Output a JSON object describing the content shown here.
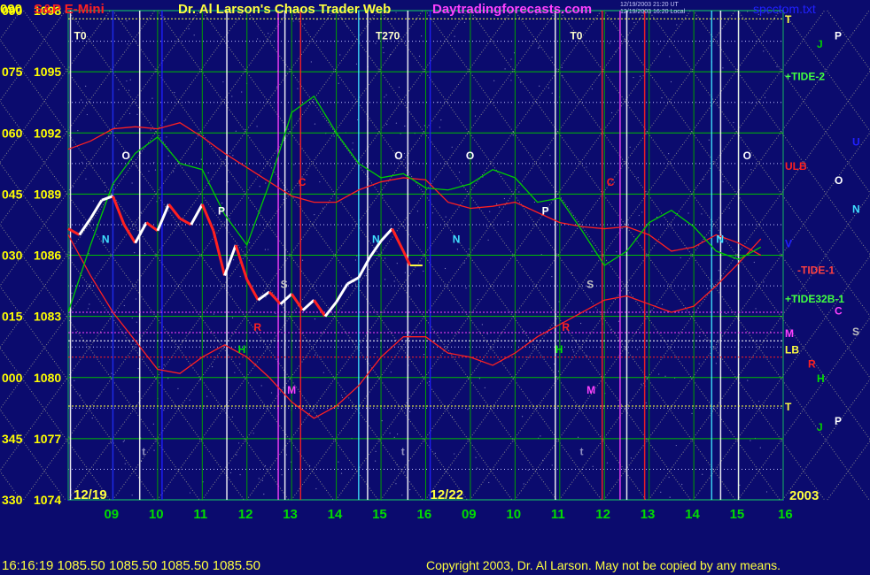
{
  "header": {
    "symbol": "S&P E-Mini",
    "title": "Dr. Al Larson's Chaos Trader Web",
    "site": "Daytradingforecasts.com",
    "timestamp_ut": "12/19/2003 21:20 UT",
    "timestamp_local": "12/19/2003 16:20 Local",
    "file": "spcctom.txt"
  },
  "footer": {
    "quote": "16:16:19  1085.50 1085.50 1085.50 1085.50",
    "copyright": "Copyright 2003, Dr. Al Larson. May not be copied by any means."
  },
  "colors": {
    "background": "#0b0b6e",
    "price_up": "#ffffff",
    "price_down": "#ff2020",
    "grid_green": "#00c000",
    "dotted_yellow": "#e8e8a0",
    "tide_green": "#00cc00",
    "ulb_red": "#ff2020"
  },
  "chart_data": {
    "type": "line",
    "ylim": [
      1074,
      1098
    ],
    "y_ticks": [
      {
        "price": "1098",
        "angle": "090"
      },
      {
        "price": "1095",
        "angle": "075"
      },
      {
        "price": "1092",
        "angle": "060"
      },
      {
        "price": "1089",
        "angle": "045"
      },
      {
        "price": "1086",
        "angle": "030"
      },
      {
        "price": "1083",
        "angle": "015"
      },
      {
        "price": "1080",
        "angle": "000"
      },
      {
        "price": "1077",
        "angle": "345"
      },
      {
        "price": "1074",
        "angle": "330"
      }
    ],
    "x_ticks": [
      "09",
      "10",
      "11",
      "12",
      "13",
      "14",
      "15",
      "16",
      "09",
      "10",
      "11",
      "12",
      "13",
      "14",
      "15",
      "16"
    ],
    "date_labels": [
      "12/19",
      "12/22"
    ],
    "year_label": "2003",
    "price_last": 1085.5,
    "price_series": [
      {
        "t": 0.0,
        "v": 1087.3
      },
      {
        "t": 0.25,
        "v": 1087.0
      },
      {
        "t": 0.5,
        "v": 1087.8
      },
      {
        "t": 0.75,
        "v": 1088.7
      },
      {
        "t": 1.0,
        "v": 1088.9
      },
      {
        "t": 1.25,
        "v": 1087.5
      },
      {
        "t": 1.5,
        "v": 1086.6
      },
      {
        "t": 1.75,
        "v": 1087.6
      },
      {
        "t": 2.0,
        "v": 1087.2
      },
      {
        "t": 2.25,
        "v": 1088.5
      },
      {
        "t": 2.5,
        "v": 1087.8
      },
      {
        "t": 2.75,
        "v": 1087.5
      },
      {
        "t": 3.0,
        "v": 1088.5
      },
      {
        "t": 3.25,
        "v": 1087.2
      },
      {
        "t": 3.5,
        "v": 1085.0
      },
      {
        "t": 3.75,
        "v": 1086.5
      },
      {
        "t": 4.0,
        "v": 1084.8
      },
      {
        "t": 4.25,
        "v": 1083.8
      },
      {
        "t": 4.5,
        "v": 1084.2
      },
      {
        "t": 4.75,
        "v": 1083.6
      },
      {
        "t": 5.0,
        "v": 1084.1
      },
      {
        "t": 5.25,
        "v": 1083.3
      },
      {
        "t": 5.5,
        "v": 1083.8
      },
      {
        "t": 5.75,
        "v": 1083.0
      },
      {
        "t": 6.0,
        "v": 1083.7
      },
      {
        "t": 6.25,
        "v": 1084.6
      },
      {
        "t": 6.5,
        "v": 1084.9
      },
      {
        "t": 6.75,
        "v": 1085.9
      },
      {
        "t": 7.0,
        "v": 1086.7
      },
      {
        "t": 7.25,
        "v": 1087.3
      },
      {
        "t": 7.5,
        "v": 1086.2
      },
      {
        "t": 7.65,
        "v": 1085.5
      }
    ],
    "tide_series": [
      {
        "t": 0.0,
        "v": 1083.2
      },
      {
        "t": 0.5,
        "v": 1086.5
      },
      {
        "t": 1.0,
        "v": 1089.5
      },
      {
        "t": 1.5,
        "v": 1091.0
      },
      {
        "t": 2.0,
        "v": 1091.8
      },
      {
        "t": 2.5,
        "v": 1090.5
      },
      {
        "t": 3.0,
        "v": 1090.2
      },
      {
        "t": 3.5,
        "v": 1088.0
      },
      {
        "t": 4.0,
        "v": 1086.5
      },
      {
        "t": 4.5,
        "v": 1089.5
      },
      {
        "t": 5.0,
        "v": 1093.0
      },
      {
        "t": 5.5,
        "v": 1093.8
      },
      {
        "t": 6.0,
        "v": 1092.0
      },
      {
        "t": 6.5,
        "v": 1090.5
      },
      {
        "t": 7.0,
        "v": 1089.8
      },
      {
        "t": 7.5,
        "v": 1090.0
      },
      {
        "t": 8.0,
        "v": 1089.3
      },
      {
        "t": 8.5,
        "v": 1089.2
      },
      {
        "t": 9.0,
        "v": 1089.5
      },
      {
        "t": 9.5,
        "v": 1090.2
      },
      {
        "t": 10.0,
        "v": 1089.8
      },
      {
        "t": 10.5,
        "v": 1088.6
      },
      {
        "t": 11.0,
        "v": 1088.8
      },
      {
        "t": 11.5,
        "v": 1087.2
      },
      {
        "t": 12.0,
        "v": 1085.5
      },
      {
        "t": 12.5,
        "v": 1086.2
      },
      {
        "t": 13.0,
        "v": 1087.6
      },
      {
        "t": 13.5,
        "v": 1088.2
      },
      {
        "t": 14.0,
        "v": 1087.4
      },
      {
        "t": 14.5,
        "v": 1086.2
      },
      {
        "t": 15.0,
        "v": 1085.8
      },
      {
        "t": 15.5,
        "v": 1086.4
      }
    ],
    "ulb_series": [
      {
        "t": 0.0,
        "v": 1091.2
      },
      {
        "t": 0.5,
        "v": 1091.6
      },
      {
        "t": 1.0,
        "v": 1092.2
      },
      {
        "t": 1.5,
        "v": 1092.3
      },
      {
        "t": 2.0,
        "v": 1092.2
      },
      {
        "t": 2.5,
        "v": 1092.5
      },
      {
        "t": 3.0,
        "v": 1091.8
      },
      {
        "t": 3.5,
        "v": 1091.0
      },
      {
        "t": 4.0,
        "v": 1090.3
      },
      {
        "t": 4.5,
        "v": 1089.6
      },
      {
        "t": 5.0,
        "v": 1088.9
      },
      {
        "t": 5.5,
        "v": 1088.6
      },
      {
        "t": 6.0,
        "v": 1088.6
      },
      {
        "t": 6.5,
        "v": 1089.2
      },
      {
        "t": 7.0,
        "v": 1089.6
      },
      {
        "t": 7.5,
        "v": 1089.8
      },
      {
        "t": 8.0,
        "v": 1089.7
      },
      {
        "t": 8.5,
        "v": 1088.6
      },
      {
        "t": 9.0,
        "v": 1088.3
      },
      {
        "t": 9.5,
        "v": 1088.4
      },
      {
        "t": 10.0,
        "v": 1088.6
      },
      {
        "t": 10.5,
        "v": 1088.1
      },
      {
        "t": 11.0,
        "v": 1087.6
      },
      {
        "t": 11.5,
        "v": 1087.4
      },
      {
        "t": 12.0,
        "v": 1087.3
      },
      {
        "t": 12.5,
        "v": 1087.4
      },
      {
        "t": 13.0,
        "v": 1087.0
      },
      {
        "t": 13.5,
        "v": 1086.2
      },
      {
        "t": 14.0,
        "v": 1086.4
      },
      {
        "t": 14.5,
        "v": 1087.0
      },
      {
        "t": 15.0,
        "v": 1086.6
      },
      {
        "t": 15.5,
        "v": 1086.0
      }
    ],
    "lower_red_series": [
      {
        "t": 0.0,
        "v": 1087.0
      },
      {
        "t": 0.5,
        "v": 1085.0
      },
      {
        "t": 1.0,
        "v": 1083.2
      },
      {
        "t": 1.5,
        "v": 1081.8
      },
      {
        "t": 2.0,
        "v": 1080.4
      },
      {
        "t": 2.5,
        "v": 1080.2
      },
      {
        "t": 3.0,
        "v": 1081.0
      },
      {
        "t": 3.5,
        "v": 1081.6
      },
      {
        "t": 4.0,
        "v": 1081.0
      },
      {
        "t": 4.5,
        "v": 1080.0
      },
      {
        "t": 5.0,
        "v": 1078.8
      },
      {
        "t": 5.5,
        "v": 1078.0
      },
      {
        "t": 6.0,
        "v": 1078.6
      },
      {
        "t": 6.5,
        "v": 1079.6
      },
      {
        "t": 7.0,
        "v": 1081.0
      },
      {
        "t": 7.5,
        "v": 1082.0
      },
      {
        "t": 8.0,
        "v": 1082.0
      },
      {
        "t": 8.5,
        "v": 1081.2
      },
      {
        "t": 9.0,
        "v": 1081.0
      },
      {
        "t": 9.5,
        "v": 1080.6
      },
      {
        "t": 10.0,
        "v": 1081.2
      },
      {
        "t": 10.5,
        "v": 1082.0
      },
      {
        "t": 11.0,
        "v": 1082.6
      },
      {
        "t": 11.5,
        "v": 1083.2
      },
      {
        "t": 12.0,
        "v": 1083.8
      },
      {
        "t": 12.5,
        "v": 1084.0
      },
      {
        "t": 13.0,
        "v": 1083.6
      },
      {
        "t": 13.5,
        "v": 1083.2
      },
      {
        "t": 14.0,
        "v": 1083.5
      },
      {
        "t": 14.5,
        "v": 1084.5
      },
      {
        "t": 15.0,
        "v": 1085.6
      },
      {
        "t": 15.5,
        "v": 1086.8
      }
    ],
    "vertical_markers": [
      "T0",
      "T270",
      "T0"
    ],
    "in_chart_labels": [
      {
        "text": "O",
        "t": 1.2,
        "v": 1090.7,
        "color": "#ffffff"
      },
      {
        "text": "O",
        "t": 7.3,
        "v": 1090.7,
        "color": "#ffffff"
      },
      {
        "text": "O",
        "t": 8.9,
        "v": 1090.7,
        "color": "#ffffff"
      },
      {
        "text": "O",
        "t": 15.1,
        "v": 1090.7,
        "color": "#ffffff"
      },
      {
        "text": "N",
        "t": 0.75,
        "v": 1086.6,
        "color": "#40e0ff"
      },
      {
        "text": "N",
        "t": 6.8,
        "v": 1086.6,
        "color": "#40e0ff"
      },
      {
        "text": "N",
        "t": 8.6,
        "v": 1086.6,
        "color": "#40e0ff"
      },
      {
        "text": "N",
        "t": 14.5,
        "v": 1086.6,
        "color": "#40e0ff"
      },
      {
        "text": "P",
        "t": 3.35,
        "v": 1088.0,
        "color": "#ffffff"
      },
      {
        "text": "P",
        "t": 10.6,
        "v": 1088.0,
        "color": "#ffffff"
      },
      {
        "text": "C",
        "t": 5.15,
        "v": 1089.4,
        "color": "#ff2020"
      },
      {
        "text": "C",
        "t": 12.05,
        "v": 1089.4,
        "color": "#ff2020"
      },
      {
        "text": "S",
        "t": 4.75,
        "v": 1084.4,
        "color": "#c0c0c0"
      },
      {
        "text": "S",
        "t": 11.6,
        "v": 1084.4,
        "color": "#c0c0c0"
      },
      {
        "text": "R",
        "t": 4.15,
        "v": 1082.3,
        "color": "#ff2020"
      },
      {
        "text": "R",
        "t": 11.05,
        "v": 1082.3,
        "color": "#ff2020"
      },
      {
        "text": "H",
        "t": 3.8,
        "v": 1081.2,
        "color": "#00e000"
      },
      {
        "text": "H",
        "t": 10.9,
        "v": 1081.2,
        "color": "#00e000"
      },
      {
        "text": "M",
        "t": 4.9,
        "v": 1079.2,
        "color": "#ff40ff"
      },
      {
        "text": "M",
        "t": 11.6,
        "v": 1079.2,
        "color": "#ff40ff"
      },
      {
        "text": "t",
        "t": 1.65,
        "v": 1076.2,
        "color": "#9090c0"
      },
      {
        "text": "t",
        "t": 7.45,
        "v": 1076.2,
        "color": "#9090c0"
      },
      {
        "text": "t",
        "t": 11.45,
        "v": 1076.2,
        "color": "#9090c0"
      }
    ],
    "right_labels": [
      {
        "text": "T",
        "v": 1097.6,
        "color": "#ffff40",
        "x": "col1"
      },
      {
        "text": "P",
        "v": 1096.8,
        "color": "#ffffff",
        "x": "col3"
      },
      {
        "text": "J",
        "v": 1096.4,
        "color": "#00cc00",
        "x": "col2"
      },
      {
        "text": "+TIDE-2",
        "v": 1094.8,
        "color": "#40ff40",
        "x": "col1"
      },
      {
        "text": "U",
        "v": 1091.6,
        "color": "#2020ff",
        "x": "col4"
      },
      {
        "text": "ULB",
        "v": 1090.4,
        "color": "#ff2020",
        "x": "col0"
      },
      {
        "text": "O",
        "v": 1089.7,
        "color": "#ffffff",
        "x": "col3"
      },
      {
        "text": "N",
        "v": 1088.3,
        "color": "#40e0ff",
        "x": "col4"
      },
      {
        "text": "V",
        "v": 1086.6,
        "color": "#2020ff",
        "x": "col1"
      },
      {
        "text": "-TIDE-1",
        "v": 1085.3,
        "color": "#ff4040",
        "x": "col1b"
      },
      {
        "text": "+TIDE32B-1",
        "v": 1083.9,
        "color": "#40ff40",
        "x": "col1"
      },
      {
        "text": "C",
        "v": 1083.3,
        "color": "#ff40ff",
        "x": "col3"
      },
      {
        "text": "M",
        "v": 1082.2,
        "color": "#ff40ff",
        "x": "col0"
      },
      {
        "text": "S",
        "v": 1082.3,
        "color": "#c0c0c0",
        "x": "col4"
      },
      {
        "text": "LB",
        "v": 1081.4,
        "color": "#ffff40",
        "x": "col1"
      },
      {
        "text": "R",
        "v": 1080.7,
        "color": "#ff2020",
        "x": "col2b"
      },
      {
        "text": "H",
        "v": 1080.0,
        "color": "#00e000",
        "x": "col2"
      },
      {
        "text": "T",
        "v": 1078.6,
        "color": "#ffff40",
        "x": "col0"
      },
      {
        "text": "P",
        "v": 1077.9,
        "color": "#ffffff",
        "x": "col3"
      },
      {
        "text": "J",
        "v": 1077.6,
        "color": "#00cc00",
        "x": "col2"
      }
    ]
  }
}
